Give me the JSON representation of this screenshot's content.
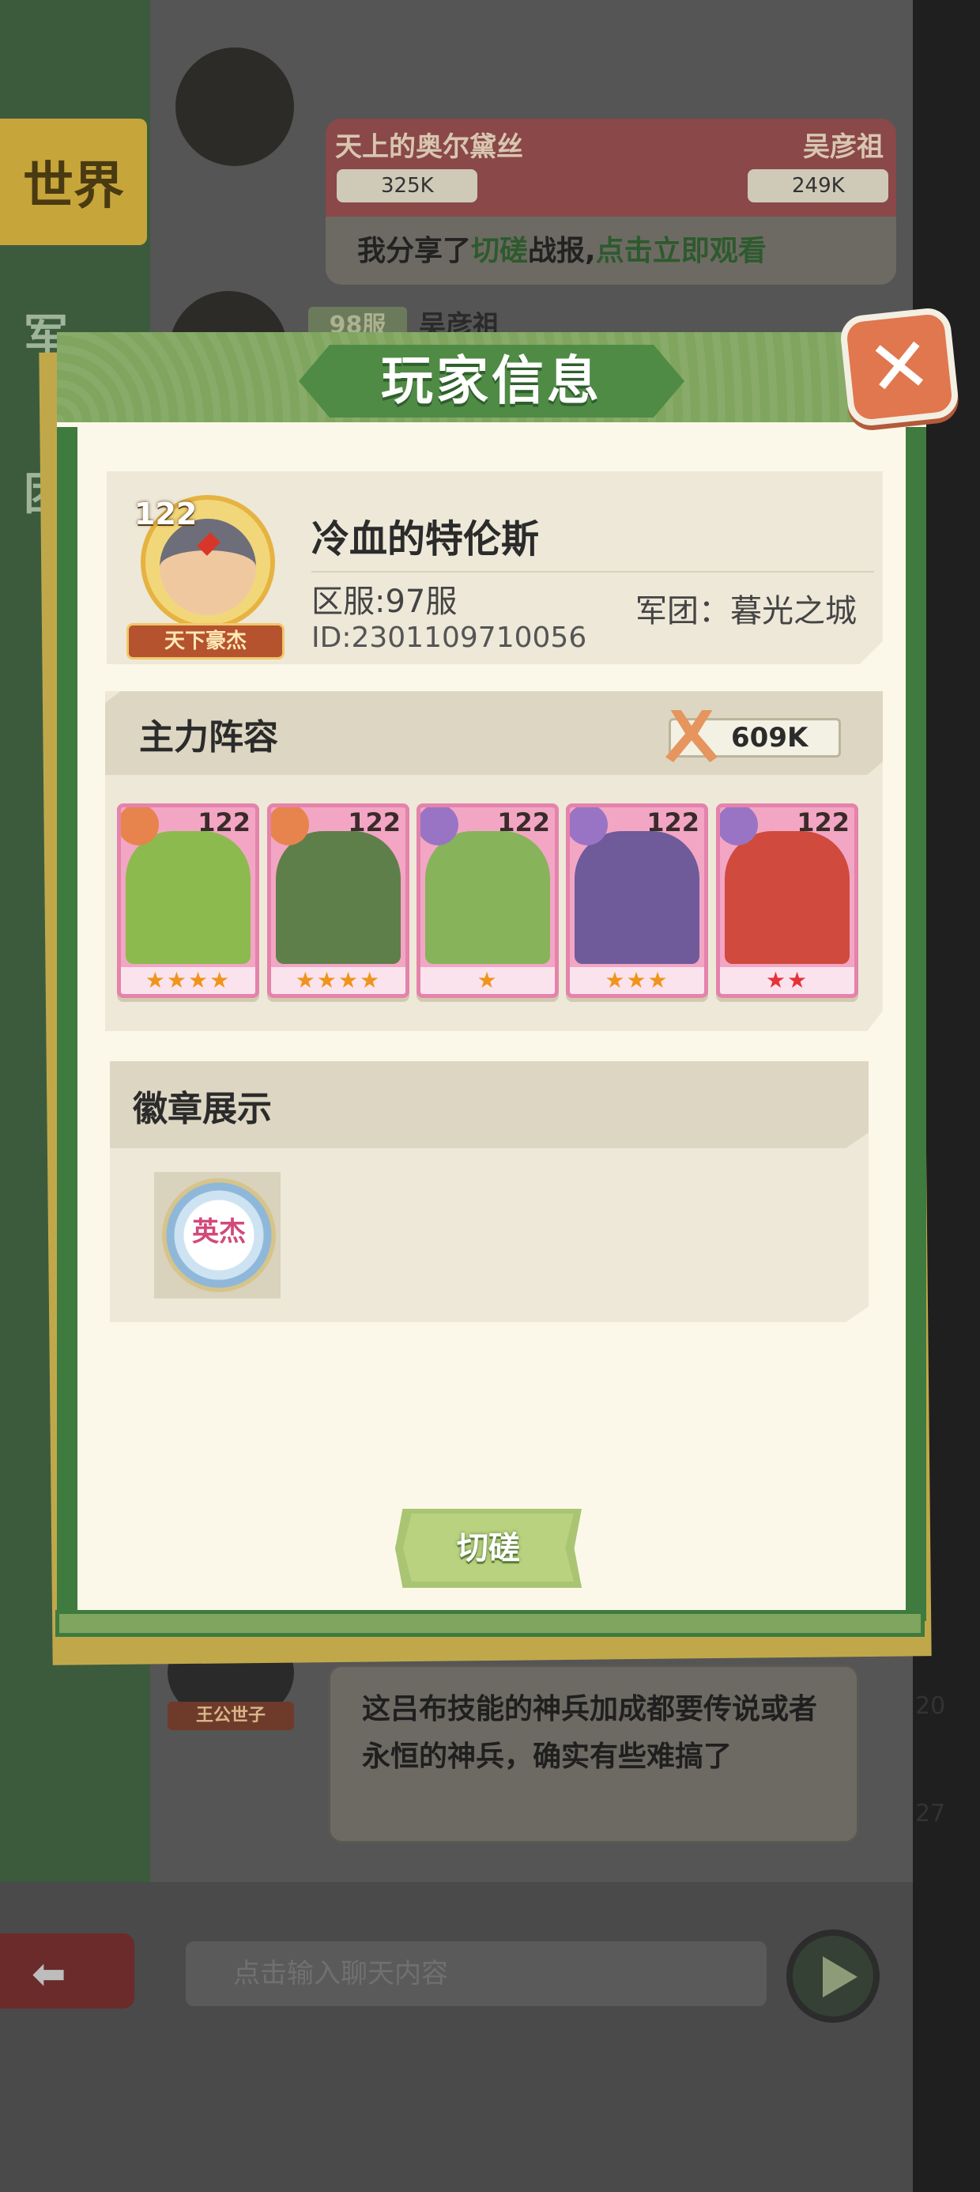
{
  "background": {
    "left_nav": {
      "active_tab": "世界",
      "items": [
        "军",
        "团"
      ]
    },
    "share_message": {
      "player_left": "天上的奥尔黛丝",
      "player_right": "吴彦祖",
      "power_left": "325K",
      "power_right": "249K",
      "text_prefix": "我分享了",
      "text_highlight1": "切磋",
      "text_mid": "战报,",
      "text_highlight2": "点击立即观看"
    },
    "next_sender": {
      "server_tag": "98服",
      "name": "吴彦祖"
    },
    "chat_message": {
      "sender_tag": "王公世子",
      "text": "这吕布技能的神兵加成都要传说或者永恒的神兵，确实有些难搞了"
    },
    "side_numbers": [
      "20",
      "27"
    ],
    "chat_input": {
      "placeholder": "点击输入聊天内容"
    }
  },
  "modal": {
    "title": "玩家信息",
    "close_label": "✕",
    "profile": {
      "level": "122",
      "title_plate": "天下豪杰",
      "name": "冷血的特伦斯",
      "server": "区服:97服",
      "guild": "军团：暮光之城",
      "id": "ID:2301109710056"
    },
    "lineup": {
      "title": "主力阵容",
      "power": "609K",
      "heroes": [
        {
          "level": "122",
          "stars": "★★★★",
          "star_color": "orange",
          "badge": "orange",
          "portrait_color": "#8cba4e"
        },
        {
          "level": "122",
          "stars": "★★★★",
          "star_color": "orange",
          "badge": "orange",
          "portrait_color": "#5f7f4a"
        },
        {
          "level": "122",
          "stars": "★",
          "star_color": "orange",
          "badge": "purple",
          "portrait_color": "#87b35a"
        },
        {
          "level": "122",
          "stars": "★★★",
          "star_color": "orange",
          "badge": "purple",
          "portrait_color": "#6f5a9a"
        },
        {
          "level": "122",
          "stars": "★★",
          "star_color": "red",
          "badge": "purple",
          "portrait_color": "#d04a3e"
        }
      ]
    },
    "badges": {
      "title": "徽章展示",
      "items": [
        {
          "label": "英杰"
        }
      ]
    },
    "spar_button": "切磋"
  }
}
